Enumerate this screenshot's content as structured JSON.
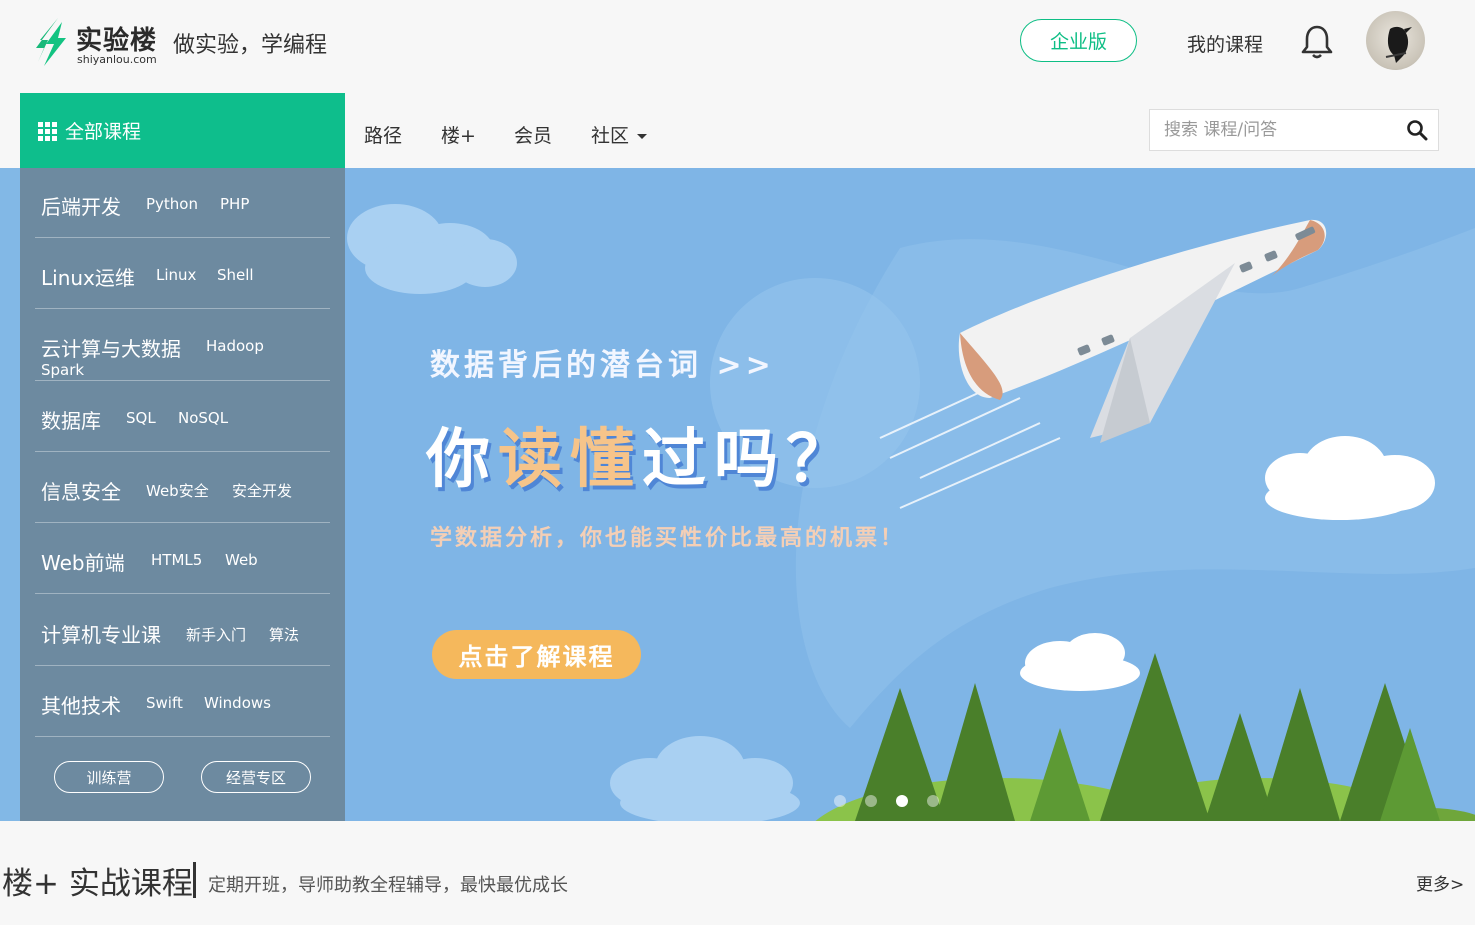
{
  "header": {
    "logo_name": "实验楼",
    "logo_domain": "shiyanlou.com",
    "slogan": "做实验，学编程",
    "enterprise_label": "企业版",
    "my_courses_label": "我的课程"
  },
  "nav": {
    "all_courses_label": "全部课程",
    "items": [
      "路径",
      "楼+",
      "会员",
      "社区"
    ],
    "search_placeholder": "搜索 课程/问答"
  },
  "sidebar": {
    "categories": [
      {
        "name": "后端开发",
        "tags": [
          "Python",
          "PHP"
        ]
      },
      {
        "name": "Linux运维",
        "tags": [
          "Linux",
          "Shell"
        ]
      },
      {
        "name": "云计算与大数据",
        "tags": [
          "Hadoop",
          "Spark"
        ]
      },
      {
        "name": "数据库",
        "tags": [
          "SQL",
          "NoSQL"
        ]
      },
      {
        "name": "信息安全",
        "tags": [
          "Web安全",
          "安全开发"
        ]
      },
      {
        "name": "Web前端",
        "tags": [
          "HTML5",
          "Web"
        ]
      },
      {
        "name": "计算机专业课",
        "tags": [
          "新手入门",
          "算法"
        ]
      },
      {
        "name": "其他技术",
        "tags": [
          "Swift",
          "Windows"
        ]
      }
    ],
    "buttons": [
      "训练营",
      "经营专区"
    ]
  },
  "banner": {
    "subtitle": "数据背后的潜台词 >>",
    "headline_part1": "你",
    "headline_highlight": "读懂",
    "headline_part2": "过吗？",
    "description": "学数据分析，你也能买性价比最高的机票！",
    "cta_label": "点击了解课程",
    "slide_count": 4,
    "active_slide": 3
  },
  "section": {
    "title": "楼+ 实战课程",
    "description": "定期开班，导师助教全程辅导，最快最优成长",
    "more_label": "更多>"
  },
  "colors": {
    "brand_green": "#0ebe8c",
    "sidebar_bg": "#6d8aa0",
    "banner_sky": "#82b8e6",
    "cta_orange": "#f5b85c"
  },
  "icons": [
    "logo-icon",
    "grid-icon",
    "caret-down-icon",
    "search-icon",
    "bell-icon"
  ]
}
